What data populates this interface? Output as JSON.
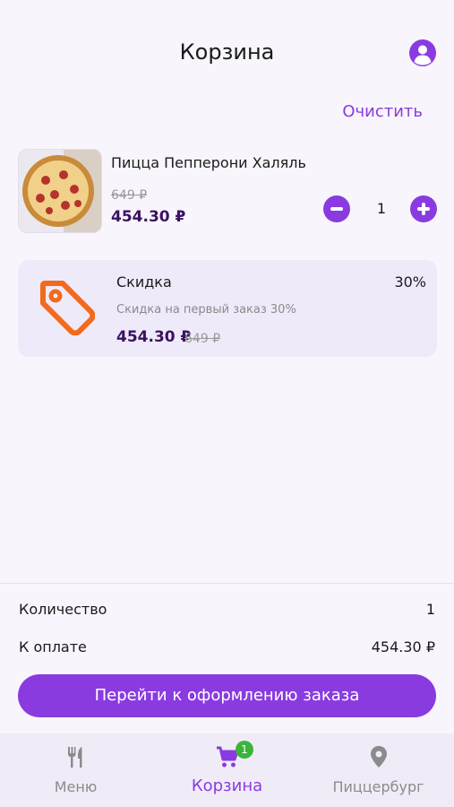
{
  "header": {
    "title": "Корзина",
    "clear_label": "Очистить"
  },
  "product": {
    "name": "Пицца Пепперони Халяль",
    "old_price": "649 ₽",
    "price": "454.30 ₽",
    "quantity": "1"
  },
  "discount": {
    "title": "Скидка",
    "percent": "30%",
    "description": "Скидка на первый заказ 30%",
    "price": "454.30 ₽",
    "old_price": "649 ₽",
    "icon": "price-tag-icon",
    "icon_color": "#f26a1b"
  },
  "summary": {
    "quantity_label": "Количество",
    "quantity_value": "1",
    "total_label": "К оплате",
    "total_value": "454.30 ₽",
    "checkout_label": "Перейти к оформлению заказа"
  },
  "nav": {
    "items": [
      {
        "label": "Меню",
        "icon": "fork-knife-icon"
      },
      {
        "label": "Корзина",
        "icon": "cart-icon",
        "badge": "1"
      },
      {
        "label": "Пиццербург",
        "icon": "location-pin-icon"
      }
    ]
  },
  "colors": {
    "accent": "#8a3be0",
    "price": "#3a1261",
    "badge": "#3bb33d"
  }
}
